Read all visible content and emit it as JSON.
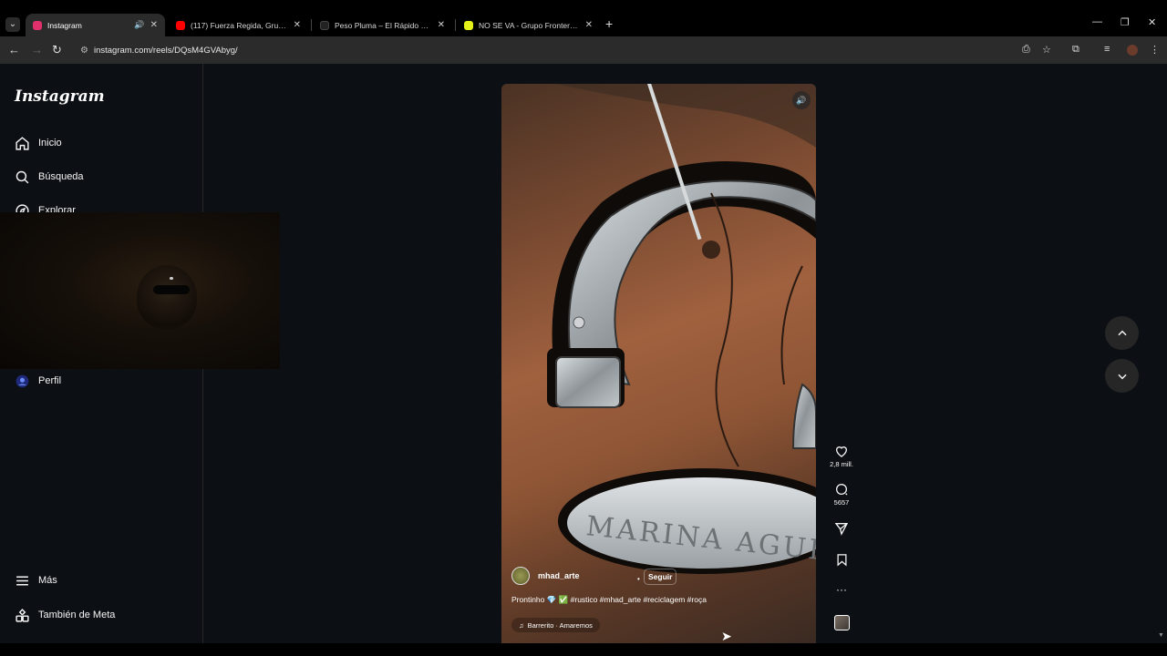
{
  "browser": {
    "tabs": [
      {
        "title": "Instagram",
        "active": true,
        "favicon_color": "#e1306c",
        "audio": true
      },
      {
        "title": "(117) Fuerza Regida, Grupo Fro",
        "active": false,
        "favicon_color": "#ff0000"
      },
      {
        "title": "Peso Pluma – El Rápido Letra |",
        "active": false,
        "favicon_color": "#222222"
      },
      {
        "title": "NO SE VA - Grupo Frontera - Li",
        "active": false,
        "favicon_color": "#e4f21a"
      }
    ],
    "url": "instagram.com/reels/DQsM4GVAbyg/"
  },
  "sidebar": {
    "logo": "Instagram",
    "items": [
      {
        "label": "Inicio",
        "icon": "home-icon"
      },
      {
        "label": "Búsqueda",
        "icon": "search-icon"
      },
      {
        "label": "Explorar",
        "icon": "compass-icon"
      },
      {
        "label": "Perfil",
        "icon": "profile-avatar"
      },
      {
        "label": "Más",
        "icon": "menu-icon"
      },
      {
        "label": "También de Meta",
        "icon": "meta-apps-icon"
      }
    ]
  },
  "reel": {
    "username": "mhad_arte",
    "follow_label": "Seguir",
    "caption": "Prontinho 💎 ✅ #rustico #mhad_arte #reciclagem #roça",
    "music": "Barrerito · Amaremos",
    "likes": "2,8 mill.",
    "comments": "5657"
  },
  "colors": {
    "page_bg": "#0c1014",
    "chrome_bg": "#2b2b2b",
    "accent_instagram": "#e1306c"
  }
}
